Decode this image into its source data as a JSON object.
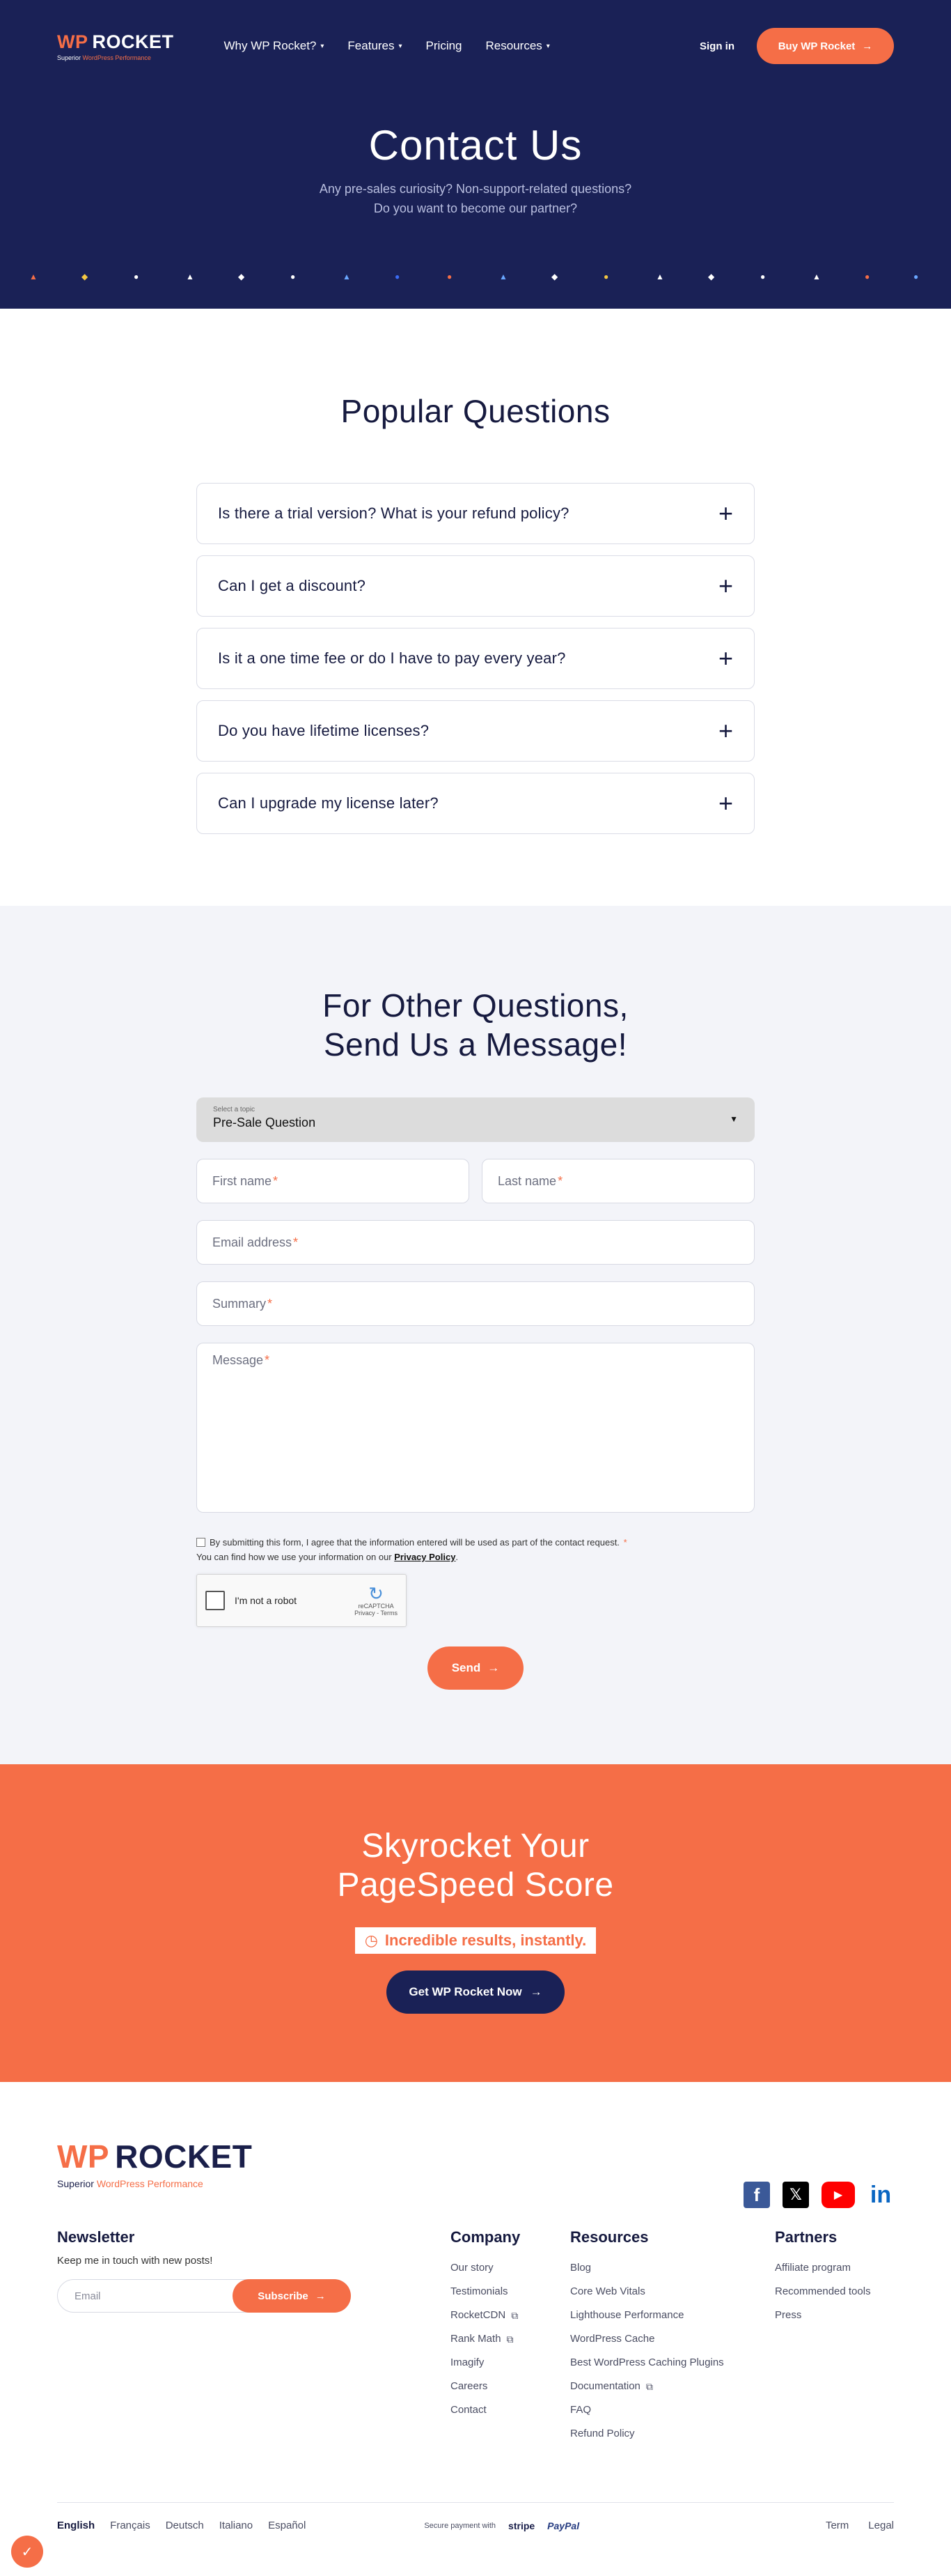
{
  "header": {
    "logo_wp": "WP",
    "logo_rocket": "ROCKET",
    "logo_tagline_a": "Superior ",
    "logo_tagline_b": "WordPress Performance",
    "nav": [
      {
        "label": "Why WP Rocket?",
        "dropdown": true
      },
      {
        "label": "Features",
        "dropdown": true
      },
      {
        "label": "Pricing",
        "dropdown": false
      },
      {
        "label": "Resources",
        "dropdown": true
      }
    ],
    "signin": "Sign in",
    "buy": "Buy WP Rocket",
    "arrow": "→",
    "caret": "▾"
  },
  "hero": {
    "title": "Contact Us",
    "subtitle_1": "Any pre-sales curiosity? Non-support-related questions?",
    "subtitle_2": "Do you want to become our partner?"
  },
  "faq": {
    "title": "Popular Questions",
    "items": [
      "Is there a trial version? What is your refund policy?",
      "Can I get a discount?",
      "Is it a one time fee or do I have to pay every year?",
      "Do you have lifetime licenses?",
      "Can I upgrade my license later?"
    ],
    "plus": "+"
  },
  "contact": {
    "title_1": "For Other Questions,",
    "title_2": "Send Us a Message!",
    "select_label": "Select a topic",
    "select_value": "Pre-Sale Question",
    "first_name": "First name",
    "last_name": "Last name",
    "email": "Email address",
    "summary": "Summary",
    "message": "Message",
    "required": "*",
    "consent_text": "By submitting this form, I agree that the information entered will be used as part of the contact request.",
    "privacy_text": "You can find how we use your information on our ",
    "privacy_link": "Privacy Policy",
    "recaptcha_label": "I'm not a robot",
    "recaptcha_brand": "reCAPTCHA",
    "recaptcha_terms": "Privacy - Terms",
    "send": "Send"
  },
  "cta": {
    "title_1": "Skyrocket Your",
    "title_2": "PageSpeed Score",
    "badge": "Incredible results, instantly.",
    "button": "Get WP Rocket Now"
  },
  "footer": {
    "logo_wp": "WP",
    "logo_rocket": "ROCKET",
    "tagline_a": "Superior ",
    "tagline_b": "WordPress Performance",
    "social": [
      "facebook-icon",
      "x-icon",
      "youtube-icon",
      "linkedin-icon"
    ],
    "newsletter": {
      "title": "Newsletter",
      "text": "Keep me in touch with new posts!",
      "placeholder": "Email",
      "button": "Subscribe"
    },
    "company": {
      "title": "Company",
      "links": [
        "Our story",
        "Testimonials",
        "RocketCDN",
        "Rank Math",
        "Imagify",
        "Careers",
        "Contact"
      ]
    },
    "resources": {
      "title": "Resources",
      "links": [
        "Blog",
        "Core Web Vitals",
        "Lighthouse Performance",
        "WordPress Cache",
        "Best WordPress Caching Plugins",
        "Documentation",
        "FAQ",
        "Refund Policy"
      ]
    },
    "partners": {
      "title": "Partners",
      "links": [
        "Affiliate program",
        "Recommended tools",
        "Press"
      ]
    },
    "languages": [
      "English",
      "Français",
      "Deutsch",
      "Italiano",
      "Español"
    ],
    "secure_payment": "Secure payment with",
    "stripe": "stripe",
    "paypal": "PayPal",
    "legal": [
      "Term",
      "Legal"
    ]
  },
  "colors": {
    "navy": "#1a2156",
    "orange": "#f56e47",
    "light_bg": "#f3f4f9"
  }
}
